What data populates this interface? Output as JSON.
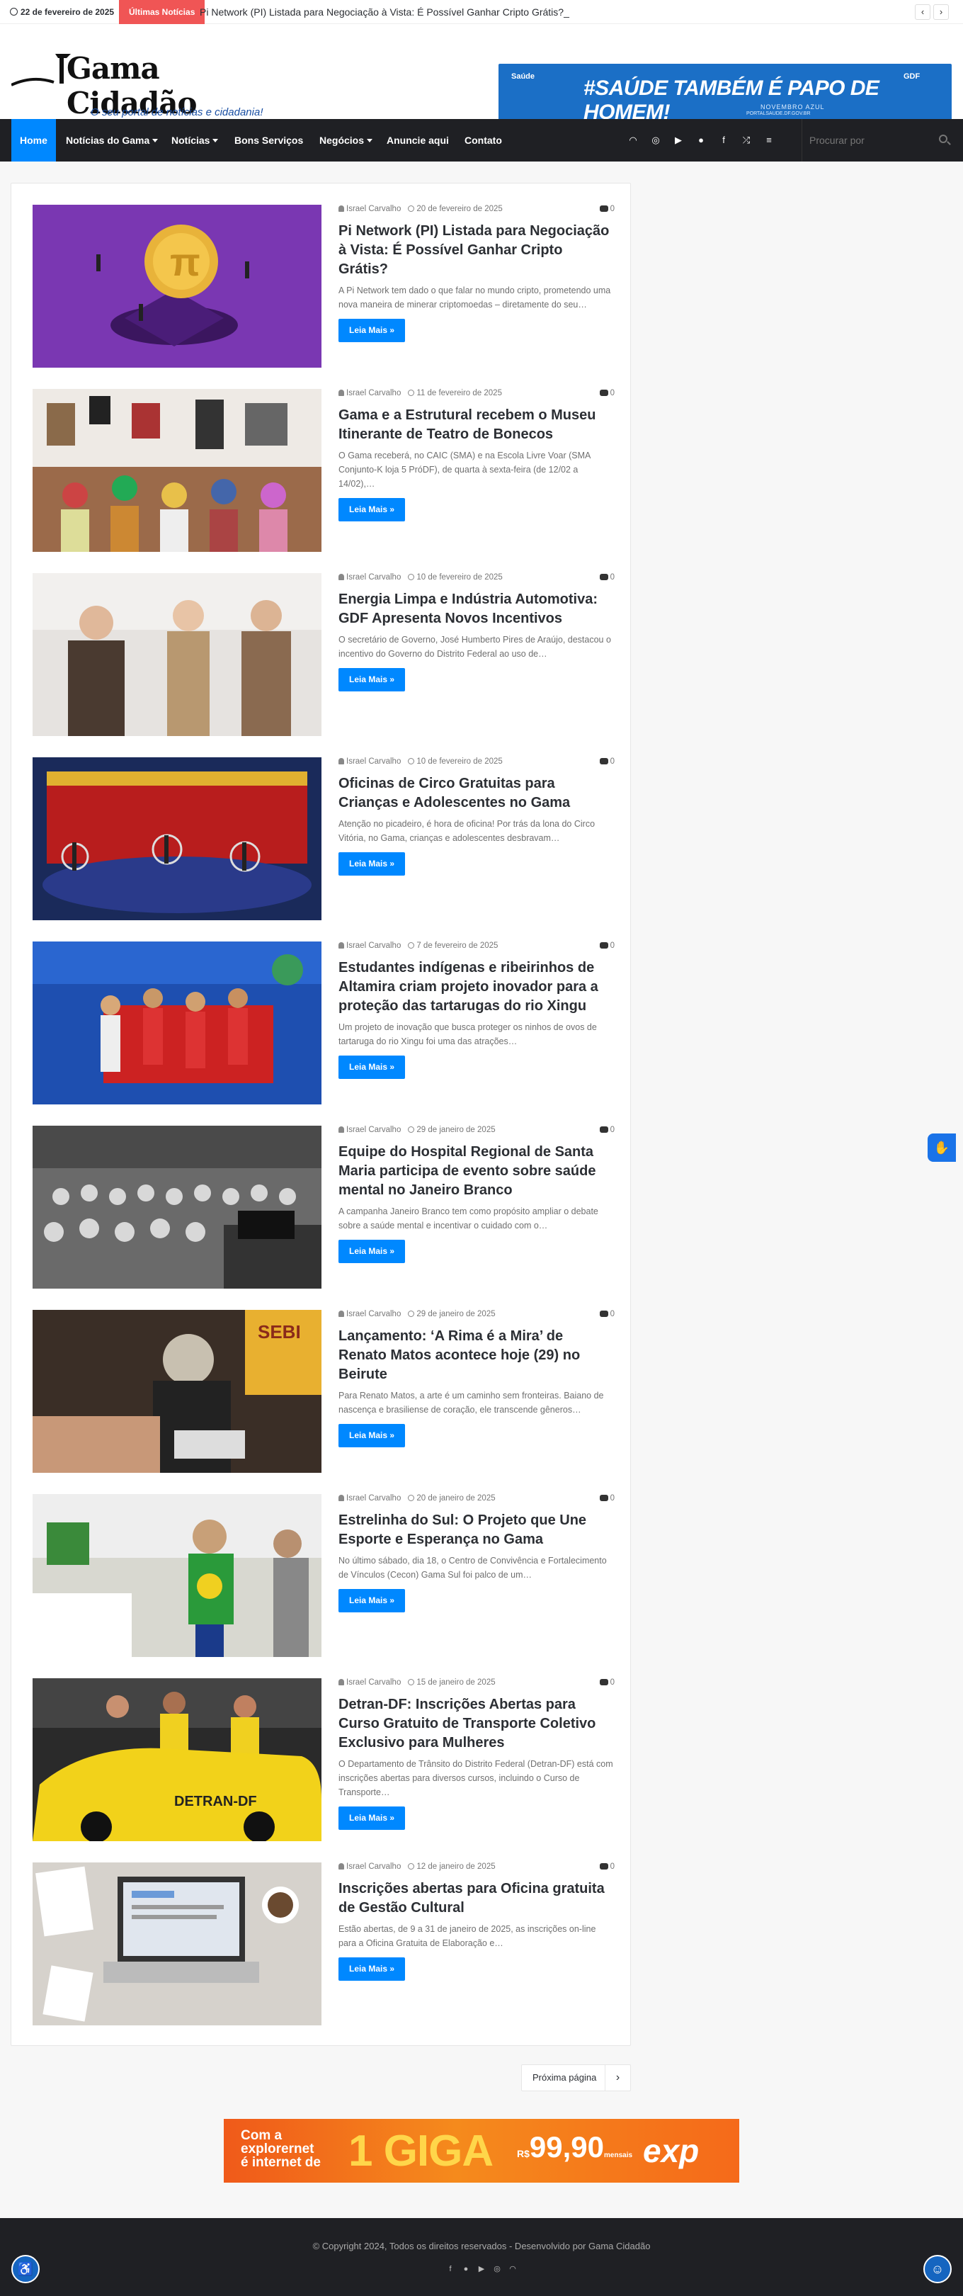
{
  "topbar": {
    "date": "22 de fevereiro de 2025",
    "label": "Últimas Notícias",
    "ticker": "Pi Network (PI) Listada para Negociação à Vista: É Possível Ganhar Cripto Grátis?_"
  },
  "logo": {
    "name": "Gama Cidadão",
    "tagline": "O seu portal de notícias e cidadania!"
  },
  "top_banner": {
    "headline": "#SAÚDE TAMBÉM É PAPO DE HOMEM!",
    "sub": "NOVEMBRO AZUL",
    "sub2": "PORTALSAUDE.DF.GOV.BR",
    "left_logo": "Saúde",
    "right_logo": "GDF"
  },
  "nav": {
    "items": [
      "Home",
      "Notícias do Gama",
      "Notícias",
      "Bons Serviços",
      "Negócios",
      "Anuncie aqui",
      "Contato"
    ],
    "search_placeholder": "Procurar por"
  },
  "posts": [
    {
      "author": "Israel Carvalho",
      "date": "20 de fevereiro de 2025",
      "comments": "0",
      "title": "Pi Network (PI) Listada para Negociação à Vista: É Possível Ganhar Cripto Grátis?",
      "excerpt": "A Pi Network tem dado o que falar no mundo cripto, prometendo uma nova maneira de minerar criptomoedas – diretamente do seu…",
      "button": "Leia Mais »"
    },
    {
      "author": "Israel Carvalho",
      "date": "11 de fevereiro de 2025",
      "comments": "0",
      "title": "Gama e a Estrutural recebem o Museu Itinerante de Teatro de Bonecos",
      "excerpt": "O Gama receberá, no CAIC (SMA) e na Escola Livre Voar (SMA Conjunto-K loja 5 PróDF), de quarta à sexta-feira (de 12/02 a 14/02),…",
      "button": "Leia Mais »"
    },
    {
      "author": "Israel Carvalho",
      "date": "10 de fevereiro de 2025",
      "comments": "0",
      "title": "Energia Limpa e Indústria Automotiva: GDF Apresenta Novos Incentivos",
      "excerpt": "O secretário de Governo, José Humberto Pires de Araújo, destacou o incentivo do Governo do Distrito Federal ao uso de…",
      "button": "Leia Mais »"
    },
    {
      "author": "Israel Carvalho",
      "date": "10 de fevereiro de 2025",
      "comments": "0",
      "title": "Oficinas de Circo Gratuitas para Crianças e Adolescentes no Gama",
      "excerpt": "Atenção no picadeiro, é hora de oficina! Por trás da lona do Circo Vitória, no Gama, crianças e adolescentes desbravam…",
      "button": "Leia Mais »"
    },
    {
      "author": "Israel Carvalho",
      "date": "7 de fevereiro de 2025",
      "comments": "0",
      "title": "Estudantes indígenas e ribeirinhos de Altamira criam projeto inovador para a proteção das tartarugas do rio Xingu",
      "excerpt": "Um projeto de inovação que busca proteger os ninhos de ovos de tartaruga do rio Xingu foi uma das atrações…",
      "button": "Leia Mais »"
    },
    {
      "author": "Israel Carvalho",
      "date": "29 de janeiro de 2025",
      "comments": "0",
      "title": "Equipe do Hospital Regional de Santa Maria participa de evento sobre saúde mental no Janeiro Branco",
      "excerpt": "A campanha Janeiro Branco tem como propósito ampliar o debate sobre a saúde mental e incentivar o cuidado com o…",
      "button": "Leia Mais »"
    },
    {
      "author": "Israel Carvalho",
      "date": "29 de janeiro de 2025",
      "comments": "0",
      "title": "Lançamento: ‘A Rima é a Mira’ de Renato Matos acontece hoje (29) no Beirute",
      "excerpt": "Para Renato Matos, a arte é um caminho sem fronteiras. Baiano de nascença e brasiliense de coração, ele transcende gêneros…",
      "button": "Leia Mais »"
    },
    {
      "author": "Israel Carvalho",
      "date": "20 de janeiro de 2025",
      "comments": "0",
      "title": "Estrelinha do Sul: O Projeto que Une Esporte e Esperança no Gama",
      "excerpt": "No último sábado, dia 18, o Centro de Convivência e Fortalecimento de Vínculos (Cecon) Gama Sul foi palco de um…",
      "button": "Leia Mais »"
    },
    {
      "author": "Israel Carvalho",
      "date": "15 de janeiro de 2025",
      "comments": "0",
      "title": "Detran-DF: Inscrições Abertas para Curso Gratuito de Transporte Coletivo Exclusivo para Mulheres",
      "excerpt": "O Departamento de Trânsito do Distrito Federal (Detran-DF) está com inscrições abertas para diversos cursos, incluindo o Curso de Transporte…",
      "button": "Leia Mais »"
    },
    {
      "author": "Israel Carvalho",
      "date": "12 de janeiro de 2025",
      "comments": "0",
      "title": "Inscrições abertas para Oficina gratuita de Gestão Cultural",
      "excerpt": "Estão abertas, de 9 a 31 de janeiro de 2025, as inscrições on-line para a Oficina Gratuita de Elaboração e…",
      "button": "Leia Mais »"
    }
  ],
  "pagination": {
    "next_label": "Próxima página"
  },
  "bottom_banner": {
    "line1": "Com a",
    "line2": "explorernet",
    "line3": "é internet de",
    "giga": "1 GIGA",
    "price_prefix": "R$",
    "price": "99,90",
    "price_unit": "mensais",
    "brand": "exp"
  },
  "footer": {
    "copyright": "© Copyright 2024, Todos os direitos reservados - Desenvolvido por Gama Cidadão"
  }
}
